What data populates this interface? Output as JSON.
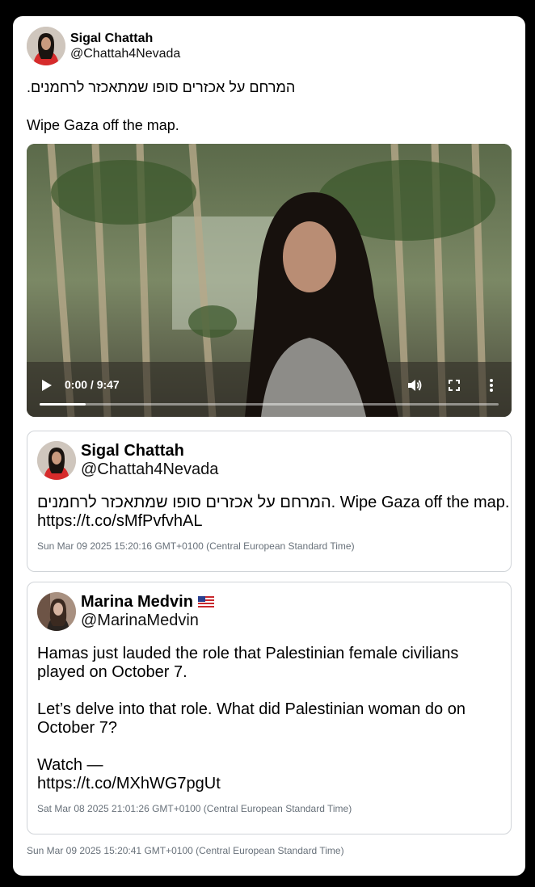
{
  "tweet": {
    "author_name": "Sigal Chattah",
    "author_handle": "@Chattah4Nevada",
    "text_hebrew": "המרחם על אכזרים סופו שמתאכזר לרחמנים.",
    "text_english": "Wipe Gaza off the map.",
    "timestamp": "Sun Mar 09 2025 15:20:41 GMT+0100 (Central European Standard Time)"
  },
  "video": {
    "time_display": "0:00 / 9:47",
    "progress_fraction": 0.1,
    "play_icon": "play-icon",
    "volume_icon": "volume-icon",
    "fullscreen_icon": "fullscreen-icon",
    "more_icon": "more-options-icon"
  },
  "quoted_tweets": [
    {
      "author_name": "Sigal Chattah",
      "author_handle": "@Chattah4Nevada",
      "text": "המרחם על אכזרים סופו שמתאכזר לרחמנים. Wipe Gaza off the map.\nhttps://t.co/sMfPvfvhAL",
      "timestamp": "Sun Mar 09 2025 15:20:16 GMT+0100 (Central European Standard Time)"
    },
    {
      "author_name": "Marina Medvin",
      "author_flag": "US flag",
      "author_handle": "@MarinaMedvin",
      "text": "Hamas just lauded the role that Palestinian female civilians played on October 7.\n\nLet’s delve into that role. What did Palestinian woman do on October 7?\n\nWatch —\nhttps://t.co/MXhWG7pgUt",
      "timestamp": "Sat Mar 08 2025 21:01:26 GMT+0100 (Central European Standard Time)"
    }
  ],
  "colors": {
    "background": "#000000",
    "card": "#ffffff",
    "muted": "#68717a",
    "border": "#d0d4d8"
  }
}
